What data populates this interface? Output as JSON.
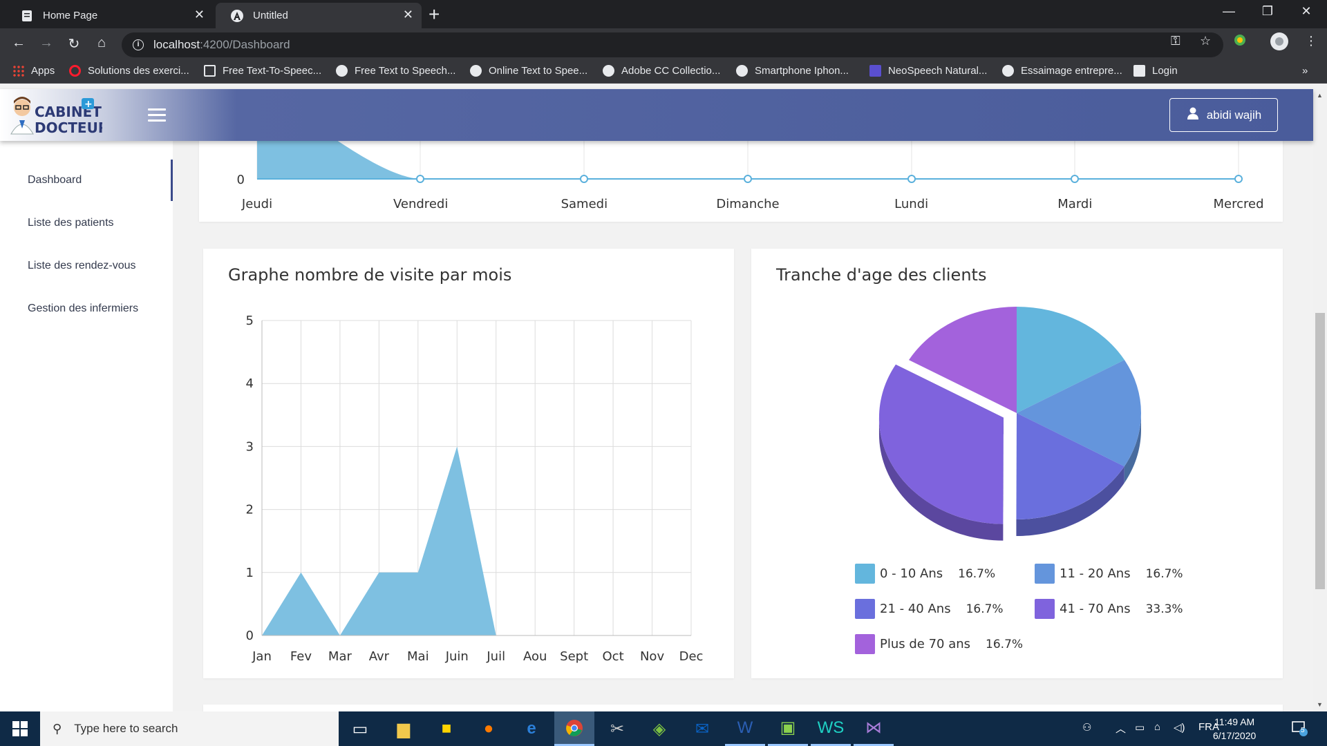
{
  "browser": {
    "tabs": [
      {
        "title": "Home Page",
        "active": false
      },
      {
        "title": "Untitled",
        "active": true
      }
    ],
    "url_host": "localhost",
    "url_path": ":4200/Dashboard",
    "bookmarks": [
      "Apps",
      "Solutions des exerci...",
      "Free Text-To-Speec...",
      "Free Text to Speech...",
      "Online Text to Spee...",
      "Adobe CC Collectio...",
      "Smartphone Iphon...",
      "NeoSpeech Natural...",
      "Essaimage entrepre...",
      "Login"
    ]
  },
  "header": {
    "logo_line1": "CABINET",
    "logo_line2": "DOCTEUR",
    "user_name": "abidi wajih"
  },
  "sidebar": {
    "items": [
      {
        "label": "Dashboard",
        "active": true
      },
      {
        "label": "Liste des patients",
        "active": false
      },
      {
        "label": "Liste des rendez-vous",
        "active": false
      },
      {
        "label": "Gestion des infermiers",
        "active": false
      }
    ]
  },
  "top_chart": {
    "zero_label": "0",
    "days": [
      "Jeudi",
      "Vendredi",
      "Samedi",
      "Dimanche",
      "Lundi",
      "Mardi",
      "Mercred"
    ]
  },
  "visits_card": {
    "title": "Graphe nombre de visite par mois"
  },
  "age_card": {
    "title": "Tranche d'age des clients",
    "legend": [
      {
        "label": "0 - 10 Ans",
        "pct": "16.7%",
        "color": "#63b6dd"
      },
      {
        "label": "11 - 20 Ans",
        "pct": "16.7%",
        "color": "#6495dc"
      },
      {
        "label": "21 - 40 Ans",
        "pct": "16.7%",
        "color": "#6a6fdd"
      },
      {
        "label": "41 - 70 Ans",
        "pct": "33.3%",
        "color": "#7f63dd"
      },
      {
        "label": "Plus de 70 ans",
        "pct": "16.7%",
        "color": "#a362dc"
      }
    ]
  },
  "chart_data": [
    {
      "type": "area",
      "x": [
        "Jan",
        "Fev",
        "Mar",
        "Avr",
        "Mai",
        "Juin",
        "Juil",
        "Aou",
        "Sept",
        "Oct",
        "Nov",
        "Dec"
      ],
      "values": [
        0,
        1,
        0,
        1,
        1,
        3,
        0,
        0,
        0,
        0,
        0,
        0
      ],
      "ylim": [
        0,
        5
      ],
      "yticks": [
        0,
        1,
        2,
        3,
        4,
        5
      ],
      "grid": true,
      "color": "#7ec0e1"
    },
    {
      "type": "pie",
      "labels": [
        "0 - 10 Ans",
        "11 - 20 Ans",
        "21 - 40 Ans",
        "41 - 70 Ans",
        "Plus de 70 ans"
      ],
      "values": [
        16.7,
        16.7,
        16.7,
        33.3,
        16.7
      ],
      "colors": [
        "#63b6dd",
        "#6495dc",
        "#6a6fdd",
        "#7f63dd",
        "#a362dc"
      ],
      "exploded": "41 - 70 Ans",
      "style": "3d"
    }
  ],
  "taskbar": {
    "search_placeholder": "Type here to search",
    "language": "FRA",
    "time": "11:49 AM",
    "date": "6/17/2020",
    "notification_count": "5"
  }
}
